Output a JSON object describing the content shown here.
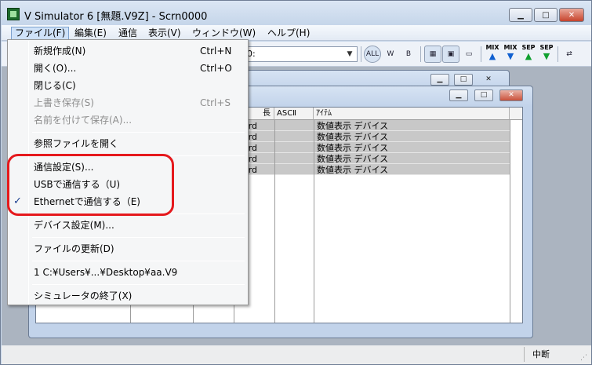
{
  "window": {
    "title": "V Simulator 6 [無題.V9Z] - Scrn0000",
    "minimize": "▁",
    "maximize": "□",
    "close": "✕"
  },
  "menubar": [
    {
      "label": "ファイル(F)",
      "active": true
    },
    {
      "label": "編集(E)"
    },
    {
      "label": "通信"
    },
    {
      "label": "表示(V)"
    },
    {
      "label": "ウィンドウ(W)"
    },
    {
      "label": "ヘルプ(H)"
    }
  ],
  "toolbar": {
    "combo_value": "0:",
    "buttons": [
      "ALL",
      "W",
      "B"
    ],
    "mix_sep": [
      {
        "label": "MIX",
        "color": "#1060d0"
      },
      {
        "label": "MIX",
        "color": "#1060d0"
      },
      {
        "label": "SEP",
        "color": "#10a030"
      },
      {
        "label": "SEP",
        "color": "#10a030"
      }
    ]
  },
  "file_menu": {
    "items": [
      {
        "label": "新規作成(N)",
        "shortcut": "Ctrl+N",
        "enabled": true
      },
      {
        "label": "開く(O)...",
        "shortcut": "Ctrl+O",
        "enabled": true
      },
      {
        "label": "閉じる(C)",
        "shortcut": "",
        "enabled": true
      },
      {
        "label": "上書き保存(S)",
        "shortcut": "Ctrl+S",
        "enabled": false
      },
      {
        "label": "名前を付けて保存(A)...",
        "shortcut": "",
        "enabled": false
      },
      {
        "label": "参照ファイルを開く",
        "shortcut": "",
        "enabled": true
      },
      {
        "label": "通信設定(S)...",
        "shortcut": "",
        "enabled": true
      },
      {
        "label": "USBで通信する（U)",
        "shortcut": "",
        "enabled": true
      },
      {
        "label": "Ethernetで通信する（E)",
        "shortcut": "",
        "enabled": true,
        "checked": true
      },
      {
        "label": "デバイス設定(M)...",
        "shortcut": "",
        "enabled": true
      },
      {
        "label": "ファイルの更新(D)",
        "shortcut": "",
        "enabled": true
      },
      {
        "label": "1 C:¥Users¥...¥Desktop¥aa.V9",
        "shortcut": "",
        "enabled": true
      },
      {
        "label": "シミュレータの終了(X)",
        "shortcut": "",
        "enabled": true
      }
    ],
    "check_mark": "✓"
  },
  "grid": {
    "headers": [
      "長",
      "ASCⅡ",
      "ｱｲﾃﾑ"
    ],
    "rows": [
      {
        "type": "ord",
        "item": "数値表示 デバイス"
      },
      {
        "type": "ord",
        "item": "数値表示 デバイス"
      },
      {
        "type": "ord",
        "item": "数値表示 デバイス"
      },
      {
        "type": "ord",
        "item": "数値表示 デバイス"
      },
      {
        "type": "ord",
        "item": "数値表示 デバイス"
      }
    ]
  },
  "statusbar": {
    "status": "中断"
  },
  "colors": {
    "highlight_ring": "#e5191d",
    "check_mark": "#1a3d8f"
  }
}
